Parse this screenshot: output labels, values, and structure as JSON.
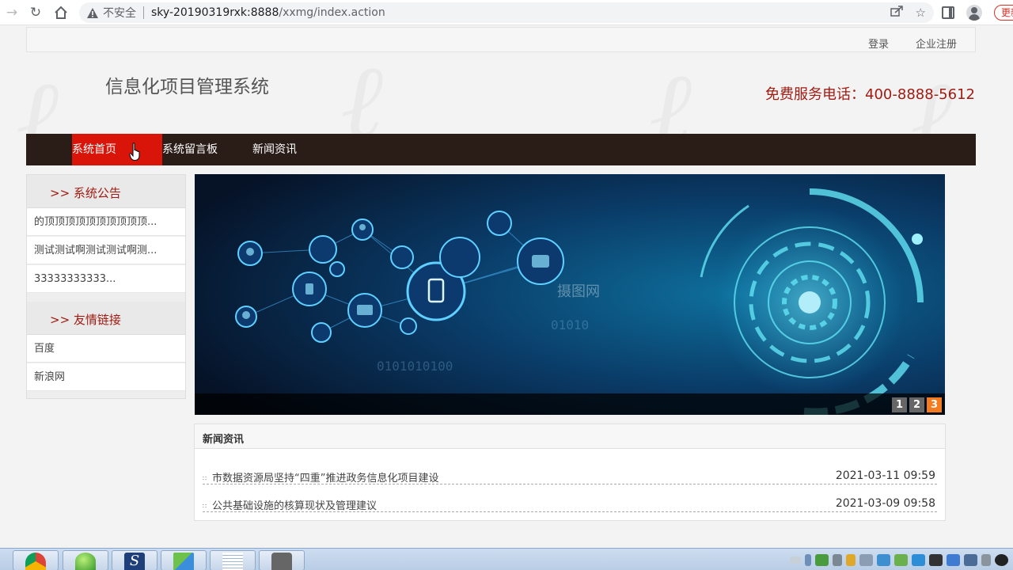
{
  "browser": {
    "insecure_label": "不安全",
    "url_host": "sky-20190319rxk:8888",
    "url_path": "/xxmg/index.action",
    "update_label": "更新"
  },
  "header": {
    "login": "登录",
    "register": "企业注册",
    "site_title": "信息化项目管理系统",
    "hotline": "免费服务电话：400-8888-5612"
  },
  "nav": {
    "items": [
      {
        "label": "系统首页"
      },
      {
        "label": "系统留言板"
      },
      {
        "label": "新闻资讯"
      }
    ]
  },
  "sidebar": {
    "announce_title": ">> 系统公告",
    "announcements": [
      {
        "label": "的顶顶顶顶顶顶顶顶顶顶..."
      },
      {
        "label": "测试测试啊测试测试啊测..."
      },
      {
        "label": "33333333333..."
      }
    ],
    "links_title": ">> 友情链接",
    "links": [
      {
        "label": "百度"
      },
      {
        "label": "新浪网"
      }
    ]
  },
  "banner": {
    "watermark": "摄图网",
    "pages": [
      "1",
      "2",
      "3"
    ],
    "current_page": 3
  },
  "news": {
    "title": "新闻资讯",
    "items": [
      {
        "title": "市数据资源局坚持“四重”推进政务信息化项目建设",
        "date": "2021-03-11 09:59"
      },
      {
        "title": "公共基础设施的核算现状及管理建议",
        "date": "2021-03-09 09:58"
      }
    ]
  },
  "icons": {
    "taskbar": [
      "chrome-icon",
      "green-app-icon",
      "script-s-icon",
      "explorer-icon",
      "notepad-icon",
      "camera-icon"
    ]
  },
  "colors": {
    "accent_red": "#d9150a",
    "nav_bg": "#2a1c17",
    "title_red": "#a01c12",
    "banner_page_active": "#f47b20"
  }
}
